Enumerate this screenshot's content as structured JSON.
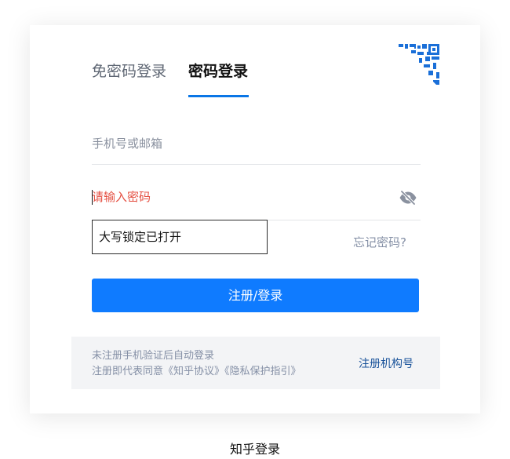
{
  "tabs": [
    {
      "label": "免密码登录",
      "active": false
    },
    {
      "label": "密码登录",
      "active": true
    }
  ],
  "account_field": {
    "placeholder": "手机号或邮箱",
    "value": ""
  },
  "password_field": {
    "placeholder": "请输入密码",
    "value": "",
    "visibility_icon": "eye-slash-icon"
  },
  "caps_lock_tooltip": "大写锁定已打开",
  "forgot_password_label": "忘记密码?",
  "submit_label": "注册/登录",
  "agreement": {
    "line1": "未注册手机验证后自动登录",
    "line2_prefix": "注册即代表同意",
    "protocol_link": "《知乎协议》",
    "privacy_link": "《隐私保护指引》",
    "org_link": "注册机构号"
  },
  "qr_corner_icon": "qr-code-icon",
  "caption": "知乎登录",
  "colors": {
    "accent": "#0f7bff",
    "tab_underline": "#0a76e6",
    "error_placeholder": "#e44f41",
    "link_muted": "#8590a6",
    "org_link": "#175199"
  }
}
